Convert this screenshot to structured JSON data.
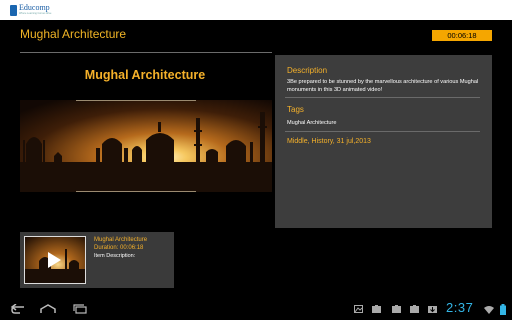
{
  "app": {
    "brand": "Educomp",
    "tagline": "Where Learning Comes Alive"
  },
  "header": {
    "title": "Mughal Architecture",
    "elapsed": "00:06:18"
  },
  "video": {
    "title": "Mughal Architecture"
  },
  "details": {
    "description_label": "Description",
    "description": "3Be prepared to be stunned by the marvellous architecture  of various Mughal monuments in this 3D animated video!",
    "tags_label": "Tags",
    "tags": "Mughal Architecture",
    "meta": "Middle, History, 31 jul,2013"
  },
  "playlist": [
    {
      "title": "Mughal Architecture",
      "duration_label": "Duration:",
      "duration": "00:06:18",
      "item_description_label": "Item Description:"
    }
  ],
  "system": {
    "clock": "2:37"
  },
  "colors": {
    "accent": "#f5b12a",
    "badge": "#f5a600",
    "panel": "#3d3d3d",
    "clock": "#33b5e5"
  }
}
